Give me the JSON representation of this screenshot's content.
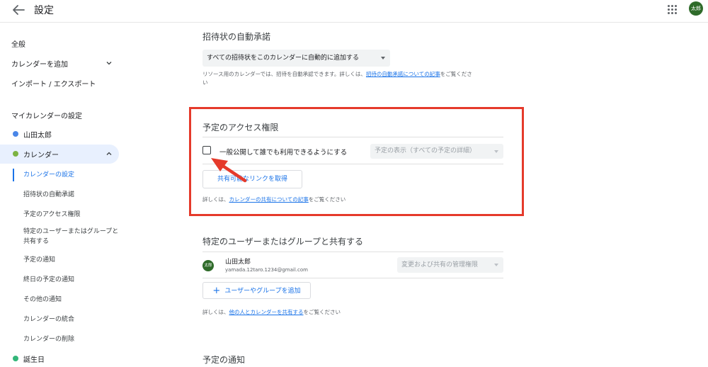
{
  "header": {
    "title": "設定",
    "avatar_text": "太郎"
  },
  "sidebar": {
    "items": [
      {
        "label": "全般"
      },
      {
        "label": "カレンダーを追加"
      },
      {
        "label": "インポート / エクスポート"
      }
    ],
    "my_calendars_heading": "マイカレンダーの設定",
    "calendars": [
      {
        "label": "山田太郎",
        "color": "#4a86e8"
      },
      {
        "label": "カレンダー",
        "color": "#7cb342"
      }
    ],
    "sub_items": [
      {
        "label": "カレンダーの設定"
      },
      {
        "label": "招待状の自動承諾"
      },
      {
        "label": "予定のアクセス権限"
      },
      {
        "label": "特定のユーザーまたはグループと共有する"
      },
      {
        "label": "予定の通知"
      },
      {
        "label": "終日の予定の通知"
      },
      {
        "label": "その他の通知"
      },
      {
        "label": "カレンダーの統合"
      },
      {
        "label": "カレンダーの削除"
      }
    ],
    "birthday": {
      "label": "誕生日",
      "color": "#33b679"
    }
  },
  "auto_accept": {
    "title": "招待状の自動承諾",
    "select_value": "すべての招待状をこのカレンダーに自動的に追加する",
    "help_prefix": "リソース用のカレンダーでは、招待を自動承認できます。詳しくは、",
    "help_link": "招待の自動承諾についての記事",
    "help_suffix": "をご覧くださ",
    "help_tail": "い"
  },
  "access": {
    "title": "予定のアクセス権限",
    "checkbox_label": "一般公開して誰でも利用できるようにする",
    "select_value": "予定の表示（すべての予定の詳細）",
    "share_link_button": "共有可能なリンクを取得",
    "help_prefix": "詳しくは、",
    "help_link": "カレンダーの共有についての記事",
    "help_suffix": "をご覧ください"
  },
  "share": {
    "title": "特定のユーザーまたはグループと共有する",
    "user": {
      "avatar": "太郎",
      "name": "山田太郎",
      "email": "yamada.12taro.1234@gmail.com"
    },
    "permission_select": "変更および共有の管理権限",
    "add_button": "ユーザーやグループを追加",
    "help_prefix": "詳しくは、",
    "help_link": "他の人とカレンダーを共有する",
    "help_suffix": "をご覧ください"
  },
  "notifications": {
    "title": "予定の通知"
  },
  "colors": {
    "accent": "#1a73e8",
    "annotation": "#e53a2b",
    "active_bg": "#e8f0fe"
  }
}
